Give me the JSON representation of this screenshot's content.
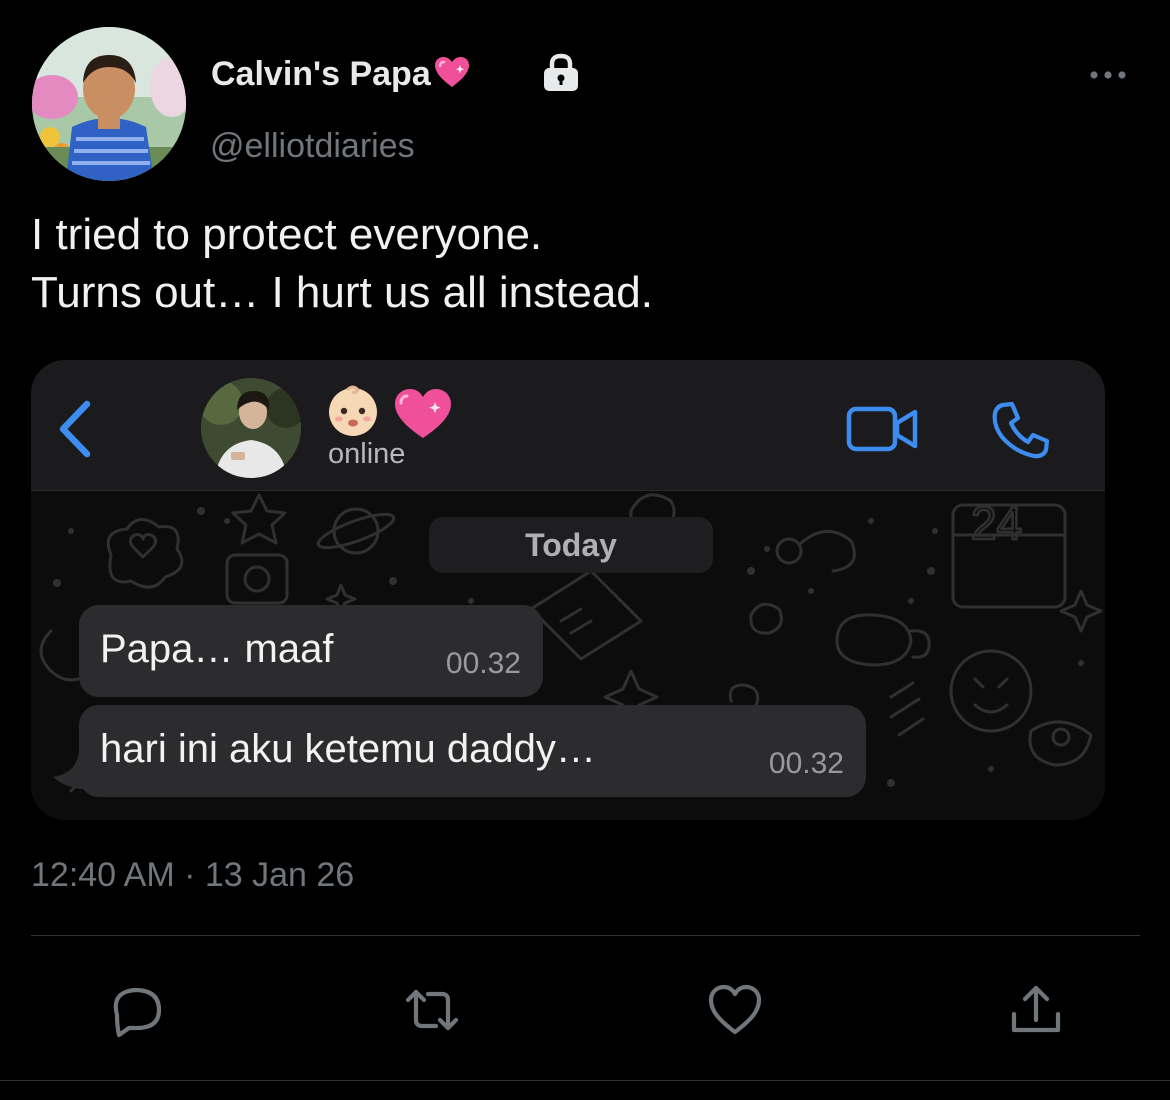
{
  "tweet": {
    "author": {
      "display_name": "Calvin's Papa",
      "name_emoji": "pink-sparkle-heart",
      "handle": "@elliotdiaries",
      "protected": true
    },
    "text_line_1": "I tried to protect everyone.",
    "text_line_2": "Turns out… I hurt us all instead.",
    "timestamp": "12:40 AM · 13 Jan 26"
  },
  "chat_screenshot": {
    "contact_name_emojis": [
      "baby-face",
      "pink-sparkle-heart"
    ],
    "status": "online",
    "date_separator": "Today",
    "messages": [
      {
        "text": "Papa… maaf",
        "time": "00.32"
      },
      {
        "text": "hari ini aku ketemu daddy…",
        "time": "00.32"
      }
    ]
  },
  "colors": {
    "background": "#000000",
    "text": "#e7e9ea",
    "secondary_text": "#71767b",
    "ios_blue": "#3d8cf0",
    "bubble": "#2c2c2e",
    "heart_pink": "#f0509a"
  }
}
